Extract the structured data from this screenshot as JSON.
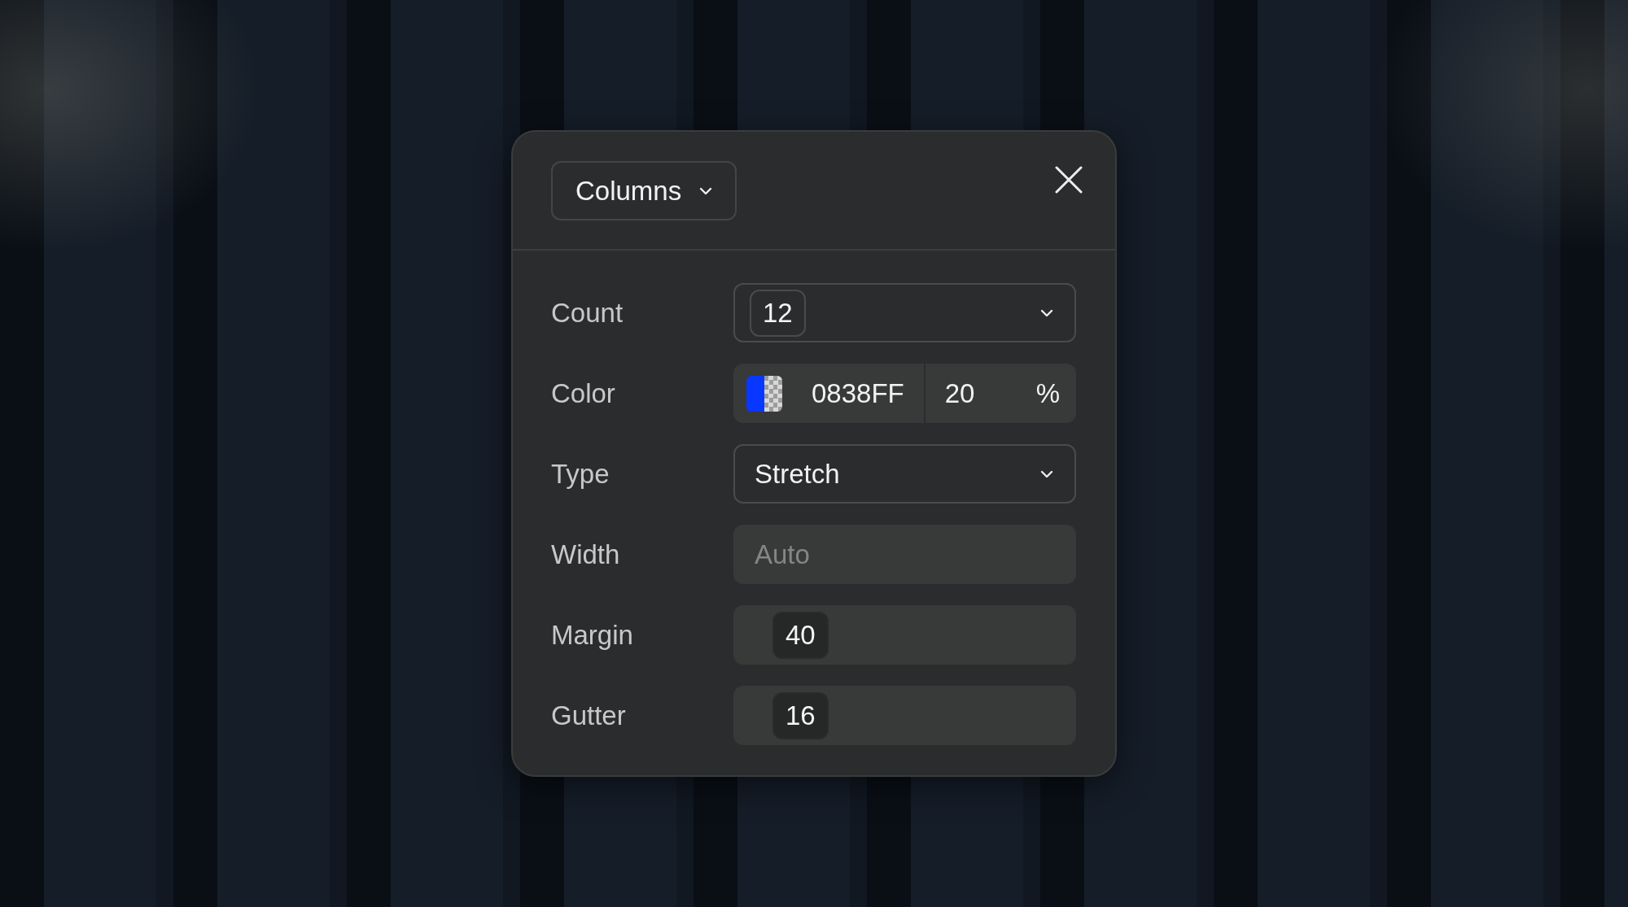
{
  "panel": {
    "layout_menu": {
      "label": "Columns"
    },
    "fields": [
      {
        "kind": "select-chip",
        "label": "Count",
        "value": "12"
      },
      {
        "kind": "color",
        "label": "Color",
        "value": "0838FF",
        "opacity": "20",
        "unit": "%"
      },
      {
        "kind": "select",
        "label": "Type",
        "value": "Stretch"
      },
      {
        "kind": "text",
        "label": "Width",
        "placeholder": "Auto"
      },
      {
        "kind": "number",
        "label": "Margin",
        "value": "40"
      },
      {
        "kind": "number",
        "label": "Gutter",
        "value": "16"
      }
    ]
  }
}
